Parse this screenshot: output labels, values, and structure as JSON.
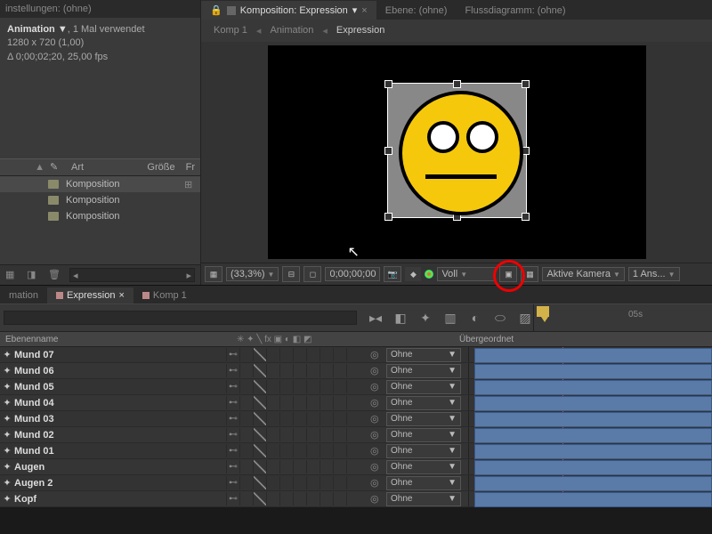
{
  "settings": {
    "title": "instellungen: (ohne)"
  },
  "compInfo": {
    "name": "Animation",
    "used": ", 1 Mal verwendet",
    "res": "1280 x 720 (1,00)",
    "dur": "Δ 0;00;02;20, 25,00 fps"
  },
  "projectHeader": {
    "art": "Art",
    "size": "Größe",
    "fr": "Fr"
  },
  "projectItems": [
    {
      "name": "Komposition"
    },
    {
      "name": "Komposition"
    },
    {
      "name": "Komposition"
    }
  ],
  "viewerTabs": {
    "main": "Komposition: Expression",
    "layer": "Ebene: (ohne)",
    "flow": "Flussdiagramm: (ohne)"
  },
  "crumbs": {
    "a": "Komp 1",
    "b": "Animation",
    "c": "Expression"
  },
  "viewerBar": {
    "zoom": "(33,3%)",
    "time": "0;00;00;00",
    "res": "Voll",
    "cam": "Aktive Kamera",
    "views": "1 Ans..."
  },
  "tlTabs": {
    "a": "mation",
    "b": "Expression",
    "c": "Komp 1"
  },
  "ruler": {
    "t5": "05s"
  },
  "colHdr": {
    "name": "Ebenenname",
    "parent": "Übergeordnet"
  },
  "parentDefault": "Ohne",
  "layers": [
    {
      "name": "Mund 07"
    },
    {
      "name": "Mund 06"
    },
    {
      "name": "Mund 05"
    },
    {
      "name": "Mund 04"
    },
    {
      "name": "Mund 03"
    },
    {
      "name": "Mund 02"
    },
    {
      "name": "Mund 01"
    },
    {
      "name": "Augen"
    },
    {
      "name": "Augen 2"
    },
    {
      "name": "Kopf"
    }
  ]
}
